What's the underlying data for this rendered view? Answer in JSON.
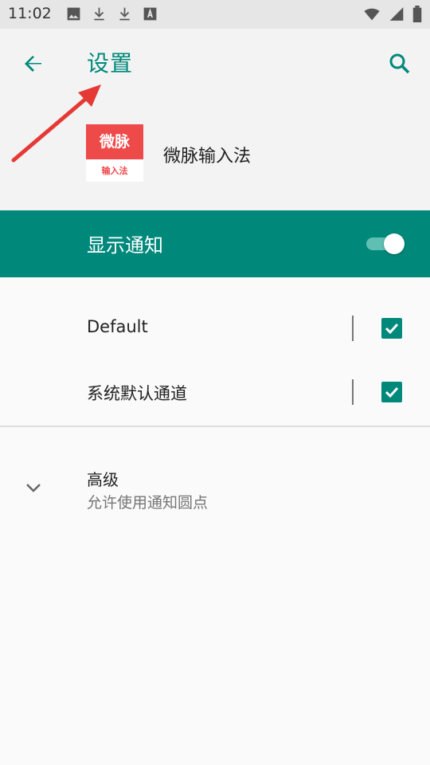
{
  "status_bar": {
    "time": "11:02"
  },
  "header": {
    "title": "设置",
    "app_name": "微脉输入法",
    "logo": {
      "top_text": "微脉",
      "bottom_text": "输入法"
    }
  },
  "notifications": {
    "label": "显示通知",
    "enabled": true
  },
  "channels": [
    {
      "label": "Default",
      "checked": true
    },
    {
      "label": "系统默认通道",
      "checked": true
    }
  ],
  "advanced": {
    "title": "高级",
    "summary": "允许使用通知圆点"
  },
  "colors": {
    "accent": "#00897b",
    "annotation_arrow": "#e53935"
  }
}
